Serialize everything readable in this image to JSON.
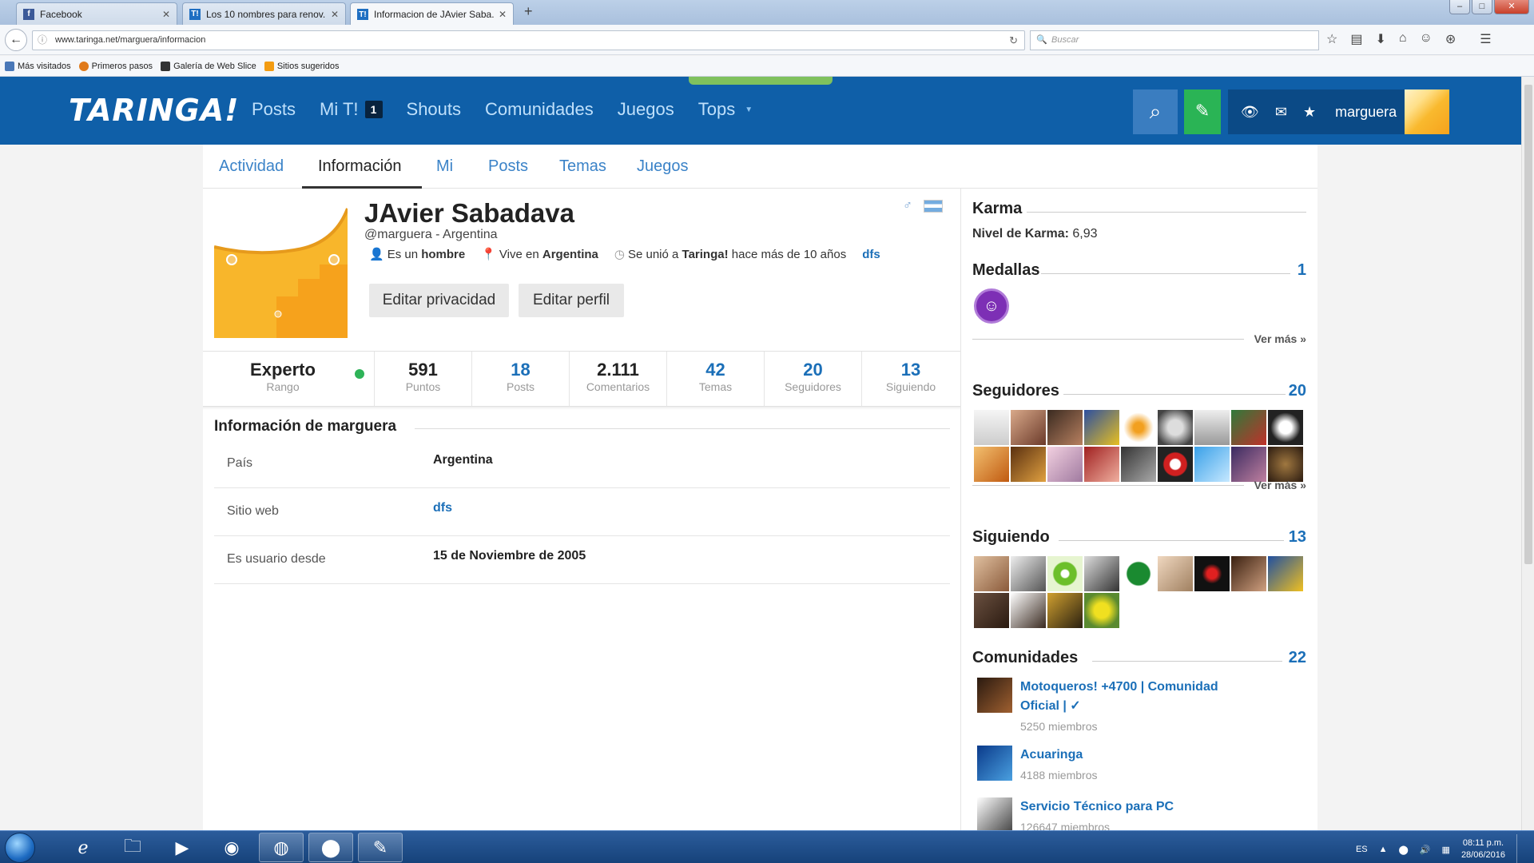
{
  "browser": {
    "tabs": [
      {
        "title": "Facebook",
        "favicon": "facebook-icon",
        "color": "#3b5998"
      },
      {
        "title": "Los 10 nombres para renov...",
        "favicon": "taringa-icon",
        "color": "#1f6fc2"
      },
      {
        "title": "Informacion de JAvier Saba...",
        "favicon": "taringa-icon",
        "color": "#1f6fc2"
      }
    ],
    "url": "www.taringa.net/marguera/informacion",
    "search_placeholder": "Buscar",
    "bookmarks": [
      "Más visitados",
      "Primeros pasos",
      "Galería de Web Slice",
      "Sitios sugeridos"
    ]
  },
  "site": {
    "logo": "TARINGA!",
    "nav": {
      "posts": "Posts",
      "mit": "Mi T!",
      "mit_badge": "1",
      "shouts": "Shouts",
      "comunidades": "Comunidades",
      "juegos": "Juegos",
      "tops": "Tops"
    },
    "username": "marguera",
    "brand_color": "#0f5fa8",
    "accent_green": "#2ab455"
  },
  "subtabs": [
    "Actividad",
    "Información",
    "Mi",
    "Posts",
    "Temas",
    "Juegos"
  ],
  "profile": {
    "name": "JAvier Sabadava",
    "handle": "@marguera - Argentina",
    "gender_prefix": "Es un",
    "gender": "hombre",
    "lives_prefix": "Vive en",
    "lives": "Argentina",
    "joined_prefix": "Se unió a",
    "joined_site": "Taringa!",
    "joined_suffix": "hace más de 10 años",
    "web_link": "dfs",
    "btn_privacy": "Editar privacidad",
    "btn_profile": "Editar perfil"
  },
  "stats": {
    "rank_value": "Experto",
    "rank_label": "Rango",
    "points_value": "591",
    "points_label": "Puntos",
    "posts_value": "18",
    "posts_label": "Posts",
    "comments_value": "2.111",
    "comments_label": "Comentarios",
    "topics_value": "42",
    "topics_label": "Temas",
    "followers_value": "20",
    "followers_label": "Seguidores",
    "following_value": "13",
    "following_label": "Siguiendo"
  },
  "info": {
    "title": "Información de marguera",
    "rows": [
      {
        "key": "País",
        "value": "Argentina"
      },
      {
        "key": "Sitio web",
        "value": "dfs"
      },
      {
        "key": "Es usuario desde",
        "value": "15 de Noviembre de 2005"
      }
    ]
  },
  "sidebar": {
    "karma_title": "Karma",
    "karma_label": "Nivel de Karma:",
    "karma_value": "6,93",
    "medals_title": "Medallas",
    "medals_count": "1",
    "ver_mas": "Ver más »",
    "followers_title": "Seguidores",
    "followers_count": "20",
    "following_title": "Siguiendo",
    "following_count": "13",
    "communities_title": "Comunidades",
    "communities_count": "22",
    "communities": [
      {
        "name": "Motoqueros! +4700 | Comunidad Oficial | ✓",
        "members": "5250 miembros"
      },
      {
        "name": "Acuaringa",
        "members": "4188 miembros"
      },
      {
        "name": "Servicio Técnico para PC",
        "members": "126647 miembros"
      }
    ]
  },
  "taskbar": {
    "lang": "ES",
    "time": "08:11 p.m.",
    "date": "28/06/2016"
  }
}
